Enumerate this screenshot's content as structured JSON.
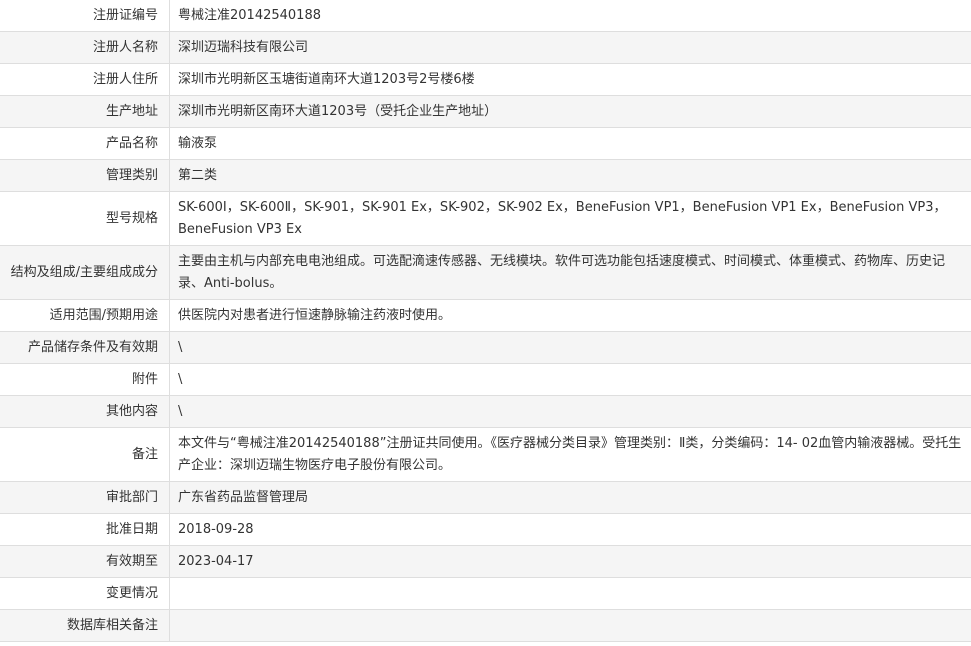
{
  "rows": [
    {
      "label": "注册证编号",
      "value": "粤械注准20142540188"
    },
    {
      "label": "注册人名称",
      "value": "深圳迈瑞科技有限公司"
    },
    {
      "label": "注册人住所",
      "value": "深圳市光明新区玉塘街道南环大道1203号2号楼6楼"
    },
    {
      "label": "生产地址",
      "value": "深圳市光明新区南环大道1203号（受托企业生产地址）"
    },
    {
      "label": "产品名称",
      "value": "输液泵"
    },
    {
      "label": "管理类别",
      "value": "第二类"
    },
    {
      "label": "型号规格",
      "value": "SK-600Ⅰ，SK-600Ⅱ，SK-901，SK-901 Ex，SK-902，SK-902 Ex，BeneFusion VP1，BeneFusion VP1 Ex，BeneFusion VP3，BeneFusion VP3 Ex"
    },
    {
      "label": "结构及组成/主要组成成分",
      "value": "主要由主机与内部充电电池组成。可选配滴速传感器、无线模块。软件可选功能包括速度模式、时间模式、体重模式、药物库、历史记录、Anti-bolus。"
    },
    {
      "label": "适用范围/预期用途",
      "value": "供医院内对患者进行恒速静脉输注药液时使用。"
    },
    {
      "label": "产品储存条件及有效期",
      "value": "\\"
    },
    {
      "label": "附件",
      "value": "\\"
    },
    {
      "label": "其他内容",
      "value": "\\"
    },
    {
      "label": "备注",
      "value": "本文件与“粤械注准20142540188”注册证共同使用。《医疗器械分类目录》管理类别：Ⅱ类，分类编码：14- 02血管内输液器械。受托生产企业：深圳迈瑞生物医疗电子股份有限公司。"
    },
    {
      "label": "审批部门",
      "value": "广东省药品监督管理局"
    },
    {
      "label": "批准日期",
      "value": "2018-09-28"
    },
    {
      "label": "有效期至",
      "value": "2023-04-17"
    },
    {
      "label": "变更情况",
      "value": ""
    },
    {
      "label": "数据库相关备注",
      "value": ""
    }
  ]
}
